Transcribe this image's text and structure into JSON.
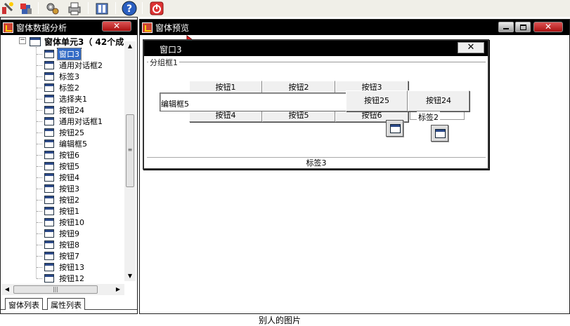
{
  "left_panel": {
    "title": "窗体数据分析",
    "root": "窗体单元3（ 42个成"
  },
  "tree_items": [
    "窗口3",
    "通用对话框2",
    "标签3",
    "标签2",
    "选择夹1",
    "按钮24",
    "通用对话框1",
    "按钮25",
    "编辑框5",
    "按钮6",
    "按钮5",
    "按钮4",
    "按钮3",
    "按钮2",
    "按钮1",
    "按钮10",
    "按钮9",
    "按钮8",
    "按钮7",
    "按钮13",
    "按钮12"
  ],
  "tabs": [
    "窗体列表",
    "属性列表"
  ],
  "right_panel": {
    "title": "窗体预览"
  },
  "form": {
    "title": "窗口3",
    "groupbox": "分组框1",
    "buttons_row1": [
      "按钮1",
      "按钮2",
      "按钮3"
    ],
    "buttons_row2": [
      "按钮4",
      "按钮5",
      "按钮6"
    ],
    "edit": "编辑框5",
    "button25": "按钮25",
    "button24": "按钮24",
    "label2": "标签2",
    "label3": "标签3"
  },
  "caption": "别人的图片",
  "icons": [
    "tools-icon",
    "wizard-icon",
    "settings-icon",
    "print-icon",
    "book-icon",
    "help-icon",
    "power-icon"
  ]
}
